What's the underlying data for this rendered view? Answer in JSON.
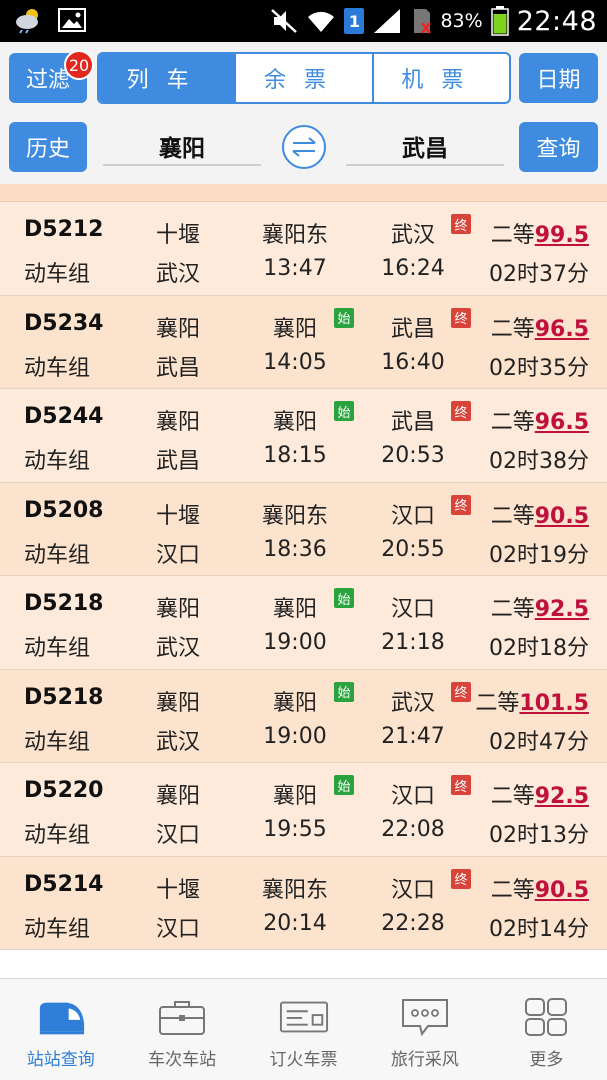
{
  "status_bar": {
    "battery": "83%",
    "time": "22:48",
    "sim": "1"
  },
  "toolbar": {
    "filter_label": "过滤",
    "filter_badge": "20",
    "tabs": [
      {
        "label": "列车",
        "active": true
      },
      {
        "label": "余票",
        "active": false
      },
      {
        "label": "机票",
        "active": false
      }
    ],
    "date_label": "日期",
    "history_label": "历史",
    "from_city": "襄阳",
    "to_city": "武昌",
    "search_label": "查询"
  },
  "trains": [
    {
      "code": "D5212",
      "type": "动车组",
      "origin": "十堰",
      "terminal": "武汉",
      "board": "襄阳东",
      "start_tag": "",
      "depart": "13:47",
      "dest": "武汉",
      "end_tag": "终",
      "arrive": "16:24",
      "seat": "二等",
      "price": "99.5",
      "duration": "02时37分"
    },
    {
      "code": "D5234",
      "type": "动车组",
      "origin": "襄阳",
      "terminal": "武昌",
      "board": "襄阳",
      "start_tag": "始",
      "depart": "14:05",
      "dest": "武昌",
      "end_tag": "终",
      "arrive": "16:40",
      "seat": "二等",
      "price": "96.5",
      "duration": "02时35分"
    },
    {
      "code": "D5244",
      "type": "动车组",
      "origin": "襄阳",
      "terminal": "武昌",
      "board": "襄阳",
      "start_tag": "始",
      "depart": "18:15",
      "dest": "武昌",
      "end_tag": "终",
      "arrive": "20:53",
      "seat": "二等",
      "price": "96.5",
      "duration": "02时38分"
    },
    {
      "code": "D5208",
      "type": "动车组",
      "origin": "十堰",
      "terminal": "汉口",
      "board": "襄阳东",
      "start_tag": "",
      "depart": "18:36",
      "dest": "汉口",
      "end_tag": "终",
      "arrive": "20:55",
      "seat": "二等",
      "price": "90.5",
      "duration": "02时19分"
    },
    {
      "code": "D5218",
      "type": "动车组",
      "origin": "襄阳",
      "terminal": "武汉",
      "board": "襄阳",
      "start_tag": "始",
      "depart": "19:00",
      "dest": "汉口",
      "end_tag": "",
      "arrive": "21:18",
      "seat": "二等",
      "price": "92.5",
      "duration": "02时18分"
    },
    {
      "code": "D5218",
      "type": "动车组",
      "origin": "襄阳",
      "terminal": "武汉",
      "board": "襄阳",
      "start_tag": "始",
      "depart": "19:00",
      "dest": "武汉",
      "end_tag": "终",
      "arrive": "21:47",
      "seat": "二等",
      "price": "101.5",
      "duration": "02时47分"
    },
    {
      "code": "D5220",
      "type": "动车组",
      "origin": "襄阳",
      "terminal": "汉口",
      "board": "襄阳",
      "start_tag": "始",
      "depart": "19:55",
      "dest": "汉口",
      "end_tag": "终",
      "arrive": "22:08",
      "seat": "二等",
      "price": "92.5",
      "duration": "02时13分"
    },
    {
      "code": "D5214",
      "type": "动车组",
      "origin": "十堰",
      "terminal": "汉口",
      "board": "襄阳东",
      "start_tag": "",
      "depart": "20:14",
      "dest": "汉口",
      "end_tag": "终",
      "arrive": "22:28",
      "seat": "二等",
      "price": "90.5",
      "duration": "02时14分"
    }
  ],
  "nav": [
    {
      "label": "站站查询",
      "icon": "train-icon",
      "active": true
    },
    {
      "label": "车次车站",
      "icon": "briefcase-icon",
      "active": false
    },
    {
      "label": "订火车票",
      "icon": "ticket-icon",
      "active": false
    },
    {
      "label": "旅行采风",
      "icon": "chat-bubble-icon",
      "active": false
    },
    {
      "label": "更多",
      "icon": "grid-icon",
      "active": false
    }
  ],
  "colors": {
    "accent": "#3f8be0",
    "price": "#c0103c",
    "start_tag": "#2aa33e",
    "end_tag": "#d9443a",
    "row_a": "#fce3ce",
    "row_b": "#fdeadb"
  }
}
